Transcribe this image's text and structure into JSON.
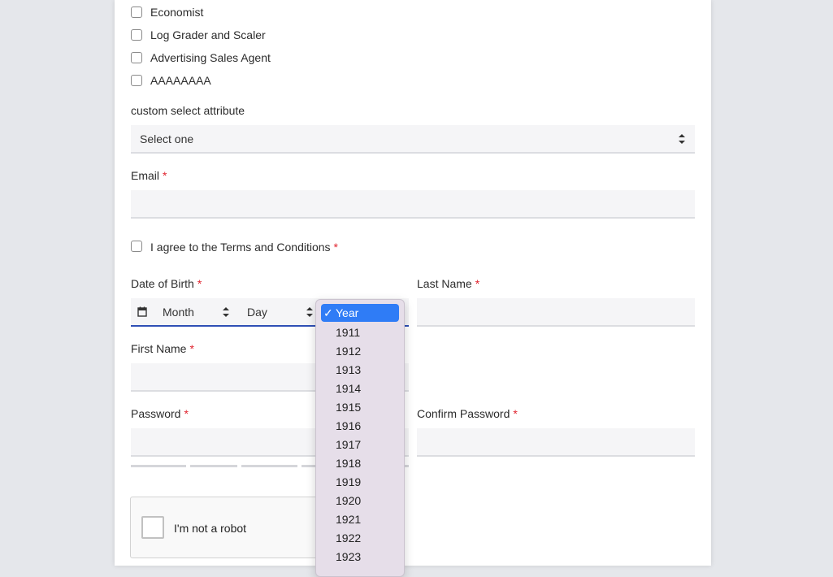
{
  "occupations": [
    "Economist",
    "Log Grader and Scaler",
    "Advertising Sales Agent",
    "AAAAAAAA"
  ],
  "custom_select": {
    "label": "custom select attribute",
    "value": "Select one"
  },
  "email": {
    "label": "Email",
    "required_mark": "*"
  },
  "terms": {
    "label": "I agree to the Terms and Conditions",
    "required_mark": "*"
  },
  "dob": {
    "label": "Date of Birth",
    "required_mark": "*",
    "month": "Month",
    "day": "Day"
  },
  "last_name": {
    "label": "Last Name",
    "required_mark": "*"
  },
  "first_name": {
    "label": "First Name",
    "required_mark": "*"
  },
  "password": {
    "label": "Password",
    "required_mark": "*"
  },
  "confirm_password": {
    "label": "Confirm Password",
    "required_mark": "*"
  },
  "recaptcha": {
    "label": "I'm not a robot"
  },
  "year_dropdown": {
    "check": "✓",
    "selected": "Year",
    "options": [
      "1911",
      "1912",
      "1913",
      "1914",
      "1915",
      "1916",
      "1917",
      "1918",
      "1919",
      "1920",
      "1921",
      "1922",
      "1923"
    ]
  },
  "colors": {
    "required": "#e0232e",
    "selected": "#2f7cf6",
    "dropdown_bg": "#e6dee9",
    "field_bg": "#f5f5f7"
  }
}
